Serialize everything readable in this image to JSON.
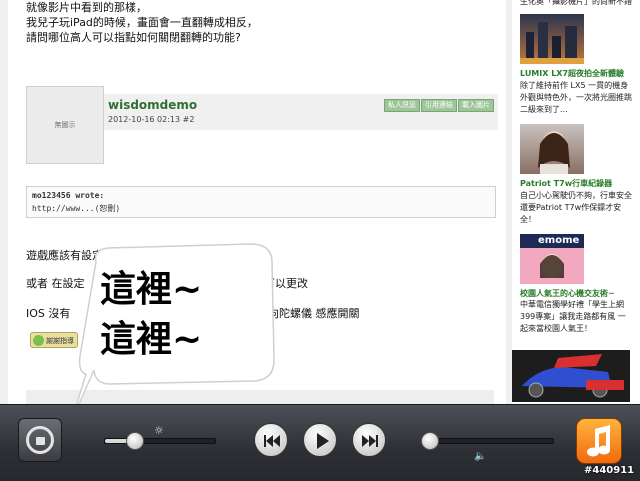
{
  "post": {
    "lines_top": [
      "就像影片中看到的那樣，",
      "我兒子玩iPad的時候，畫面會一直翻轉成相反，",
      "請問哪位高人可以指點如何關閉翻轉的功能?"
    ],
    "avatar_placeholder": "無圖示",
    "username": "wisdomdemo",
    "date": "2012-10-16 02:13",
    "post_number": "#2",
    "header_buttons": [
      "私人訊息",
      "引用連結",
      "載入圖片"
    ],
    "quote_author": "mo123456 wrote:",
    "quote_body": "http://www...(恕刪)",
    "reply_lines": [
      "遊戲應該有設定裡面可以設定...",
      "或者 在設定",
      "可以更改",
      "IOS 沒有",
      "向陀螺儀 感應開關"
    ],
    "thanks_label": "謝謝指導"
  },
  "callout": {
    "lines": [
      "這裡~",
      "這裡~"
    ]
  },
  "sidebar": {
    "top_partial": "生化奧「攝影機片」的尚新不錯",
    "items": [
      {
        "title": "LUMIX LX7超夜拍全新體驗",
        "desc": "除了維持前作 LX5 一貫的機身外觀與特色外，一次將光圈推跳二級來到了..."
      },
      {
        "title": "Patriot T7w行車紀錄器",
        "desc": "自己小心駕駛仍不夠，行車安全還要Patriot T7w作保鏢才安全！"
      },
      {
        "title": "校園人氣王的心機交友術~",
        "desc": "中華電信獨學好禮「學生上網399專案」讓我走路都有風 一起來當校園人氣王！"
      }
    ],
    "thumb_label": "emome"
  },
  "dock": {
    "brightness_level": 0.27,
    "volume_level": 0.04,
    "buttons": [
      "previous-track",
      "play",
      "next-track"
    ],
    "icons": {
      "lock": "rotation-lock-icon",
      "brightness": "brightness-icon",
      "volume": "speaker-icon",
      "app": "music-app-icon"
    }
  },
  "watermark": "#440911"
}
